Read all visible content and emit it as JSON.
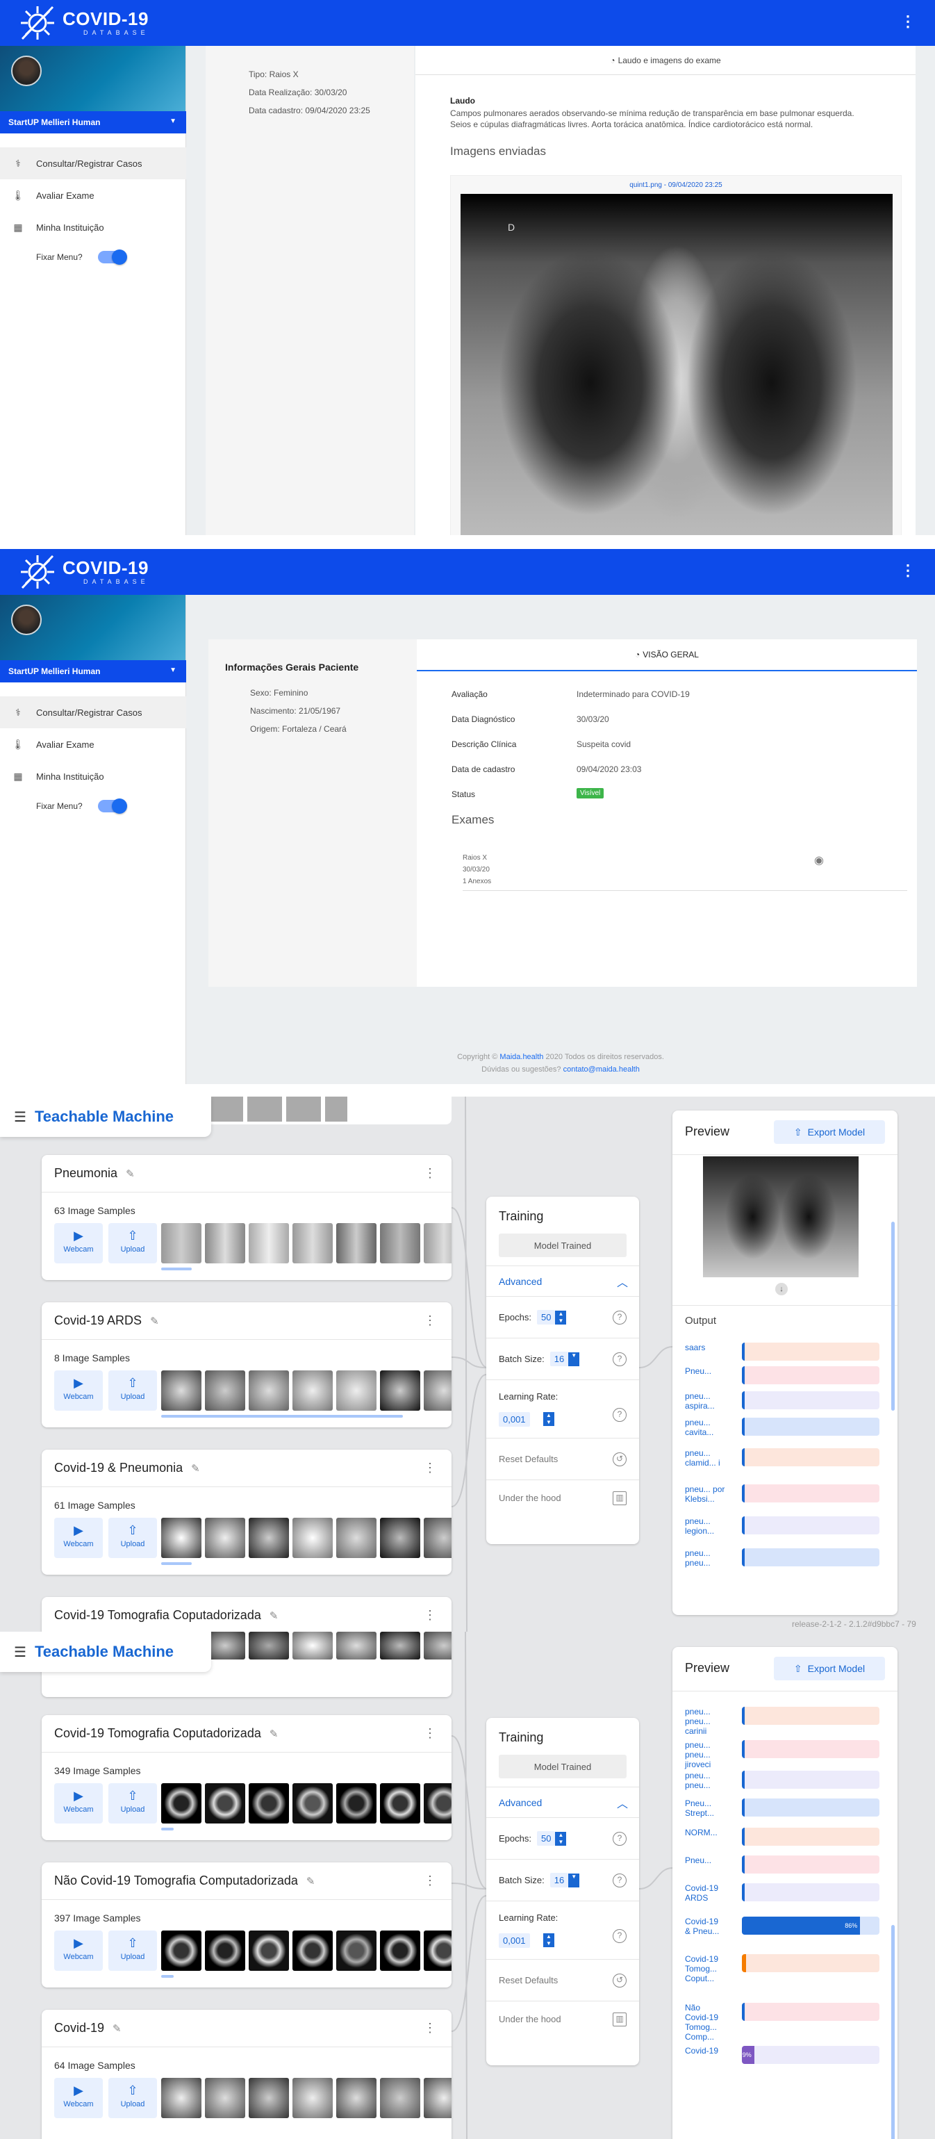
{
  "app": {
    "brand": "COVID-19",
    "brand_sub": "DATABASE"
  },
  "sidebar": {
    "org": "StartUP Mellieri Human",
    "items": [
      {
        "label": "Consultar/Registrar Casos"
      },
      {
        "label": "Avaliar Exame"
      },
      {
        "label": "Minha Instituição"
      }
    ],
    "fixar_menu": "Fixar Menu?"
  },
  "exam_view": {
    "tipo": "Tipo: Raios X",
    "data_realizacao": "Data Realização: 30/03/20",
    "data_cadastro": "Data cadastro: 09/04/2020 23:25",
    "tab_label": "Laudo e imagens do exame",
    "laudo_label": "Laudo",
    "laudo_text_1": "Campos pulmonares aerados observando-se mínima redução de transparência em base pulmonar esquerda.",
    "laudo_text_2": "Seios e cúpulas diafragmáticas livres. Aorta torácica anatômica. Índice cardiotorácico está normal.",
    "imagens_title": "Imagens enviadas",
    "image_caption": "quint1.png - 09/04/2020 23:25",
    "xray_marker": "D"
  },
  "patient_view": {
    "info_title": "Informações Gerais Paciente",
    "sexo": "Sexo: Feminino",
    "nascimento": "Nascimento: 21/05/1967",
    "origem": "Origem: Fortaleza / Ceará",
    "tab_label": "VISÃO GERAL",
    "fields": [
      {
        "label": "Avaliação",
        "value": "Indeterminado para COVID-19"
      },
      {
        "label": "Data Diagnóstico",
        "value": "30/03/20"
      },
      {
        "label": "Descrição Clínica",
        "value": "Suspeita covid"
      },
      {
        "label": "Data de cadastro",
        "value": "09/04/2020 23:03"
      }
    ],
    "status_label": "Status",
    "status_badge": "Visível",
    "exames_title": "Exames",
    "exam_item": {
      "tipo": "Raios X",
      "data": "30/03/20",
      "anexos": "1 Anexos"
    },
    "footer_1": "Copyright ©",
    "footer_link": "Maida.health",
    "footer_2": "2020 Todos os direitos reservados.",
    "footer_3": "Dúvidas ou sugestões?",
    "footer_mail": "contato@maida.health"
  },
  "tm": {
    "title": "Teachable Machine",
    "webcam": "Webcam",
    "upload": "Upload",
    "classes_a": [
      {
        "name": "Pneumonia",
        "samples": "63 Image Samples"
      },
      {
        "name": "Covid-19 ARDS",
        "samples": "8 Image Samples"
      },
      {
        "name": "Covid-19 & Pneumonia",
        "samples": "61 Image Samples"
      },
      {
        "name": "Covid-19 Tomografia Coputadorizada"
      }
    ],
    "classes_b": [
      {
        "name": "Covid-19 Tomografia Coputadorizada",
        "samples": "349 Image Samples"
      },
      {
        "name": "Não Covid-19 Tomografia Computadorizada",
        "samples": "397 Image Samples"
      },
      {
        "name": "Covid-19",
        "samples": "64 Image Samples"
      }
    ],
    "training": {
      "title": "Training",
      "trained": "Model Trained",
      "advanced": "Advanced",
      "epochs_label": "Epochs:",
      "epochs": "50",
      "batch_label": "Batch Size:",
      "batch": "16",
      "lr_label": "Learning Rate:",
      "lr": "0,001",
      "reset": "Reset Defaults",
      "under": "Under the hood"
    },
    "preview": {
      "title": "Preview",
      "export": "Export Model",
      "output": "Output"
    },
    "outputs_a": [
      {
        "label": "saars",
        "color": "#fde6dc",
        "value": 0
      },
      {
        "label": "Pneu...",
        "color": "#fde2e6",
        "value": 0
      },
      {
        "label": "pneu... aspira...",
        "color": "#ecebfb",
        "value": 0
      },
      {
        "label": "pneu... cavita...",
        "color": "#d7e4fb",
        "value": 0
      },
      {
        "label": "pneu... clamid... i",
        "color": "#fde6dc",
        "value": 0
      },
      {
        "label": "pneu... por Klebsi...",
        "color": "#fde2e6",
        "value": 0
      },
      {
        "label": "pneu... legion...",
        "color": "#ecebfb",
        "value": 0
      },
      {
        "label": "pneu... pneu...",
        "color": "#d7e4fb",
        "value": 0.01
      }
    ],
    "outputs_b": [
      {
        "label": "pneu... pneu... carinii",
        "color": "#fde6dc",
        "value": 0
      },
      {
        "label": "pneu... pneu... jiroveci",
        "color": "#fde2e6",
        "value": 0
      },
      {
        "label": "pneu... pneu...",
        "color": "#ecebfb",
        "value": 0
      },
      {
        "label": "Pneu... Strept...",
        "color": "#d7e4fb",
        "value": 0
      },
      {
        "label": "NORM...",
        "color": "#fde6dc",
        "value": 0
      },
      {
        "label": "Pneu...",
        "color": "#fde2e6",
        "value": 0
      },
      {
        "label": "Covid-19 ARDS",
        "color": "#ecebfb",
        "value": 0
      },
      {
        "label": "Covid-19 & Pneu...",
        "color": "#d7e4fb",
        "fill": "#1967d2",
        "value": 0.86,
        "text": "86%"
      },
      {
        "label": "Covid-19 Tomog... Coput...",
        "color": "#fde6dc",
        "fill": "#f57c00",
        "value": 0.03
      },
      {
        "label": "Não Covid-19 Tomog... Comp...",
        "color": "#fde2e6",
        "value": 0
      },
      {
        "label": "Covid-19",
        "color": "#ecebfb",
        "fill": "#7e57c2",
        "value": 0.09,
        "text": "9%"
      }
    ],
    "version": "release-2-1-2 - 2.1.2#d9bbc7 - 79"
  }
}
